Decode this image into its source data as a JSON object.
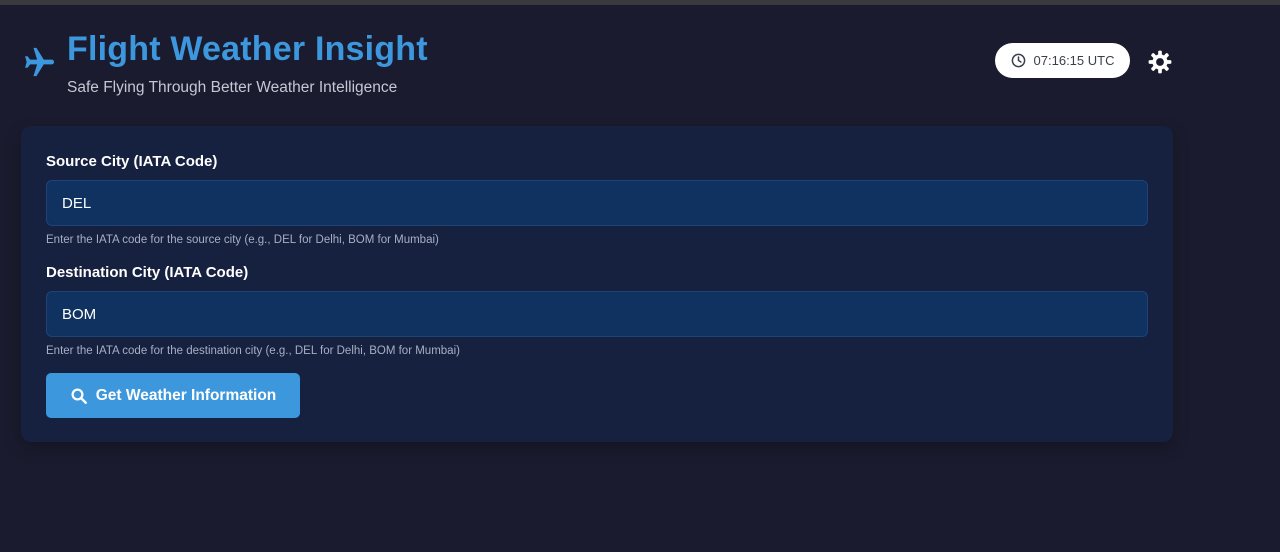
{
  "app": {
    "title": "Flight Weather Insight",
    "subtitle": "Safe Flying Through Better Weather Intelligence"
  },
  "header": {
    "clock_text": "07:16:15 UTC",
    "clock_icon": "clock-icon",
    "settings_icon": "gear-icon",
    "brand_icon": "airplane-icon"
  },
  "form": {
    "source": {
      "label": "Source City (IATA Code)",
      "value": "DEL",
      "help": "Enter the IATA code for the source city (e.g., DEL for Delhi, BOM for Mumbai)"
    },
    "destination": {
      "label": "Destination City (IATA Code)",
      "value": "BOM",
      "help": "Enter the IATA code for the destination city (e.g., DEL for Delhi, BOM for Mumbai)"
    },
    "submit_label": "Get Weather Information",
    "submit_icon": "search-icon"
  },
  "colors": {
    "background": "#1a1b2e",
    "card": "#162140",
    "accent": "#3d97dc",
    "input_bg": "#0f3260"
  }
}
